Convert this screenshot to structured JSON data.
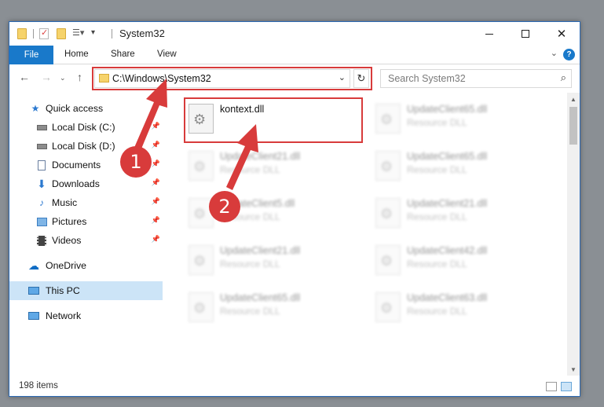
{
  "window": {
    "title": "System32"
  },
  "ribbon": {
    "tabs": [
      "File",
      "Home",
      "Share",
      "View"
    ],
    "help": "?"
  },
  "address": {
    "path": "C:\\Windows\\System32"
  },
  "search": {
    "placeholder": "Search System32"
  },
  "sidebar": {
    "items": [
      {
        "label": "Quick access",
        "icon": "star-icon"
      },
      {
        "label": "Local Disk (C:)",
        "icon": "drive-icon",
        "pinned": true
      },
      {
        "label": "Local Disk (D:)",
        "icon": "drive-icon",
        "pinned": true
      },
      {
        "label": "Documents",
        "icon": "documents-icon",
        "pinned": true
      },
      {
        "label": "Downloads",
        "icon": "download-icon",
        "pinned": true
      },
      {
        "label": "Music",
        "icon": "music-icon",
        "pinned": true
      },
      {
        "label": "Pictures",
        "icon": "pictures-icon",
        "pinned": true
      },
      {
        "label": "Videos",
        "icon": "videos-icon",
        "pinned": true
      },
      {
        "label": "OneDrive",
        "icon": "cloud-icon"
      },
      {
        "label": "This PC",
        "icon": "computer-icon",
        "selected": true
      },
      {
        "label": "Network",
        "icon": "network-icon"
      }
    ]
  },
  "files": [
    {
      "name": "kontext.dll",
      "type": ""
    },
    {
      "name": "UpdateClient65.dll",
      "type": "Resource DLL"
    },
    {
      "name": "UpdateClient21.dll",
      "type": "Resource DLL"
    },
    {
      "name": "UpdateClient65.dll",
      "type": "Resource DLL"
    },
    {
      "name": "UpdateClient5.dll",
      "type": "Resource DLL"
    },
    {
      "name": "UpdateClient21.dll",
      "type": "Resource DLL"
    },
    {
      "name": "UpdateClient21.dll",
      "type": "Resource DLL"
    },
    {
      "name": "UpdateClient42.dll",
      "type": "Resource DLL"
    },
    {
      "name": "UpdateClient65.dll",
      "type": "Resource DLL"
    },
    {
      "name": "UpdateClient63.dll",
      "type": "Resource DLL"
    }
  ],
  "status": {
    "items_count": "198 items"
  },
  "callouts": [
    "1",
    "2"
  ],
  "colors": {
    "accent": "#1979ca",
    "highlight": "#d83b3b",
    "selected": "#cce4f7"
  }
}
